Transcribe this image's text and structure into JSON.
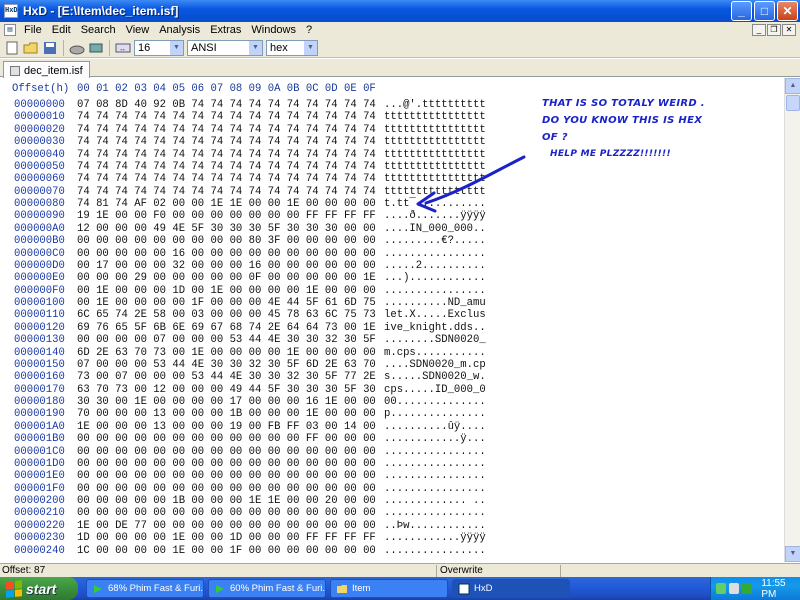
{
  "window": {
    "title": "HxD - [E:\\Item\\dec_item.isf]",
    "app_icon": "HxD",
    "minimize_icon": "_",
    "maximize_icon": "□",
    "close_icon": "✕"
  },
  "menu": {
    "items": [
      "File",
      "Edit",
      "Search",
      "View",
      "Analysis",
      "Extras",
      "Windows",
      "?"
    ]
  },
  "toolbar": {
    "bytes_per_row": "16",
    "charset": "ANSI",
    "display_mode": "hex"
  },
  "tab": {
    "label": "dec_item.isf"
  },
  "editor": {
    "offset_header": "Offset(h)",
    "column_header": "00 01 02 03 04 05 06 07 08 09 0A 0B 0C 0D 0E 0F",
    "rows": [
      {
        "offset": "00000000",
        "hex": "07 08 8D 40 92 0B 74 74 74 74 74 74 74 74 74 74",
        "ascii": "...@'.tttttttttt"
      },
      {
        "offset": "00000010",
        "hex": "74 74 74 74 74 74 74 74 74 74 74 74 74 74 74 74",
        "ascii": "tttttttttttttttt"
      },
      {
        "offset": "00000020",
        "hex": "74 74 74 74 74 74 74 74 74 74 74 74 74 74 74 74",
        "ascii": "tttttttttttttttt"
      },
      {
        "offset": "00000030",
        "hex": "74 74 74 74 74 74 74 74 74 74 74 74 74 74 74 74",
        "ascii": "tttttttttttttttt"
      },
      {
        "offset": "00000040",
        "hex": "74 74 74 74 74 74 74 74 74 74 74 74 74 74 74 74",
        "ascii": "tttttttttttttttt"
      },
      {
        "offset": "00000050",
        "hex": "74 74 74 74 74 74 74 74 74 74 74 74 74 74 74 74",
        "ascii": "tttttttttttttttt"
      },
      {
        "offset": "00000060",
        "hex": "74 74 74 74 74 74 74 74 74 74 74 74 74 74 74 74",
        "ascii": "tttttttttttttttt"
      },
      {
        "offset": "00000070",
        "hex": "74 74 74 74 74 74 74 74 74 74 74 74 74 74 74 74",
        "ascii": "tttttttttttttttt"
      },
      {
        "offset": "00000080",
        "hex": "74 81 74 AF 02 00 00 1E 1E 00 00 1E 00 00 00 00",
        "ascii": "t.tt¯..........."
      },
      {
        "offset": "00000090",
        "hex": "19 1E 00 00 F0 00 00 00 00 00 00 00 FF FF FF FF",
        "ascii": "....ð.......ÿÿÿÿ"
      },
      {
        "offset": "000000A0",
        "hex": "12 00 00 00 49 4E 5F 30 30 30 5F 30 30 30 00 00",
        "ascii": "....IN_000_000.."
      },
      {
        "offset": "000000B0",
        "hex": "00 00 00 00 00 00 00 00 00 80 3F 00 00 00 00 00",
        "ascii": ".........€?....."
      },
      {
        "offset": "000000C0",
        "hex": "00 00 00 00 00 16 00 00 00 00 00 00 00 00 00 00",
        "ascii": "................"
      },
      {
        "offset": "000000D0",
        "hex": "00 17 00 00 00 32 00 00 00 16 00 00 00 00 00 00",
        "ascii": ".....2.........."
      },
      {
        "offset": "000000E0",
        "hex": "00 00 00 29 00 00 00 00 00 0F 00 00 00 00 00 1E",
        "ascii": "...)............"
      },
      {
        "offset": "000000F0",
        "hex": "00 1E 00 00 00 1D 00 1E 00 00 00 00 1E 00 00 00",
        "ascii": "................"
      },
      {
        "offset": "00000100",
        "hex": "00 1E 00 00 00 00 1F 00 00 00 4E 44 5F 61 6D 75",
        "ascii": "..........ND_amu"
      },
      {
        "offset": "00000110",
        "hex": "6C 65 74 2E 58 00 03 00 00 00 45 78 63 6C 75 73",
        "ascii": "let.X.....Exclus"
      },
      {
        "offset": "00000120",
        "hex": "69 76 65 5F 6B 6E 69 67 68 74 2E 64 64 73 00 1E",
        "ascii": "ive_knight.dds.."
      },
      {
        "offset": "00000130",
        "hex": "00 00 00 00 07 00 00 00 53 44 4E 30 30 32 30 5F",
        "ascii": "........SDN0020_"
      },
      {
        "offset": "00000140",
        "hex": "6D 2E 63 70 73 00 1E 00 00 00 00 1E 00 00 00 00",
        "ascii": "m.cps..........."
      },
      {
        "offset": "00000150",
        "hex": "07 00 00 00 53 44 4E 30 30 32 30 5F 6D 2E 63 70",
        "ascii": "....SDN0020_m.cp"
      },
      {
        "offset": "00000160",
        "hex": "73 00 07 00 00 00 53 44 4E 30 30 32 30 5F 77 2E",
        "ascii": "s.....SDN0020_w."
      },
      {
        "offset": "00000170",
        "hex": "63 70 73 00 12 00 00 00 49 44 5F 30 30 30 5F 30",
        "ascii": "cps.....ID_000_0"
      },
      {
        "offset": "00000180",
        "hex": "30 30 00 1E 00 00 00 00 17 00 00 00 16 1E 00 00",
        "ascii": "00.............."
      },
      {
        "offset": "00000190",
        "hex": "70 00 00 00 13 00 00 00 1B 00 00 00 1E 00 00 00",
        "ascii": "p..............."
      },
      {
        "offset": "000001A0",
        "hex": "1E 00 00 00 13 00 00 00 19 00 FB FF 03 00 14 00",
        "ascii": "..........ûÿ...."
      },
      {
        "offset": "000001B0",
        "hex": "00 00 00 00 00 00 00 00 00 00 00 00 FF 00 00 00",
        "ascii": "............ÿ..."
      },
      {
        "offset": "000001C0",
        "hex": "00 00 00 00 00 00 00 00 00 00 00 00 00 00 00 00",
        "ascii": "................"
      },
      {
        "offset": "000001D0",
        "hex": "00 00 00 00 00 00 00 00 00 00 00 00 00 00 00 00",
        "ascii": "................"
      },
      {
        "offset": "000001E0",
        "hex": "00 00 00 00 00 00 00 00 00 00 00 00 00 00 00 00",
        "ascii": "................"
      },
      {
        "offset": "000001F0",
        "hex": "00 00 00 00 00 00 00 00 00 00 00 00 00 00 00 00",
        "ascii": "................"
      },
      {
        "offset": "00000200",
        "hex": "00 00 00 00 00 1B 00 00 00 1E 1E 00 00 20 00 00",
        "ascii": "............. .."
      },
      {
        "offset": "00000210",
        "hex": "00 00 00 00 00 00 00 00 00 00 00 00 00 00 00 00",
        "ascii": "................"
      },
      {
        "offset": "00000220",
        "hex": "1E 00 DE 77 00 00 00 00 00 00 00 00 00 00 00 00",
        "ascii": "..Þw............"
      },
      {
        "offset": "00000230",
        "hex": "1D 00 00 00 00 1E 00 00 1D 00 00 00 FF FF FF FF",
        "ascii": "............ÿÿÿÿ"
      },
      {
        "offset": "00000240",
        "hex": "1C 00 00 00 00 1E 00 00 1F 00 00 00 00 00 00 00",
        "ascii": "................"
      }
    ]
  },
  "annotation": {
    "line1": "THAT IS SO TOTALY WEIRD .",
    "line2": "DO YOU KNOW THIS IS HEX",
    "line3": "OF ?",
    "line4": "HELP ME PLZZZZ!!!!!!!",
    "color": "#1a22c8"
  },
  "status": {
    "offset": "Offset: 87",
    "mode": "Overwrite"
  },
  "taskbar": {
    "start_label": "start",
    "buttons": [
      {
        "label": "68% Phim Fast & Furi..."
      },
      {
        "label": "60% Phim Fast & Furi..."
      },
      {
        "label": "Item"
      },
      {
        "label": "HxD"
      }
    ],
    "clock": "11:55 PM"
  }
}
